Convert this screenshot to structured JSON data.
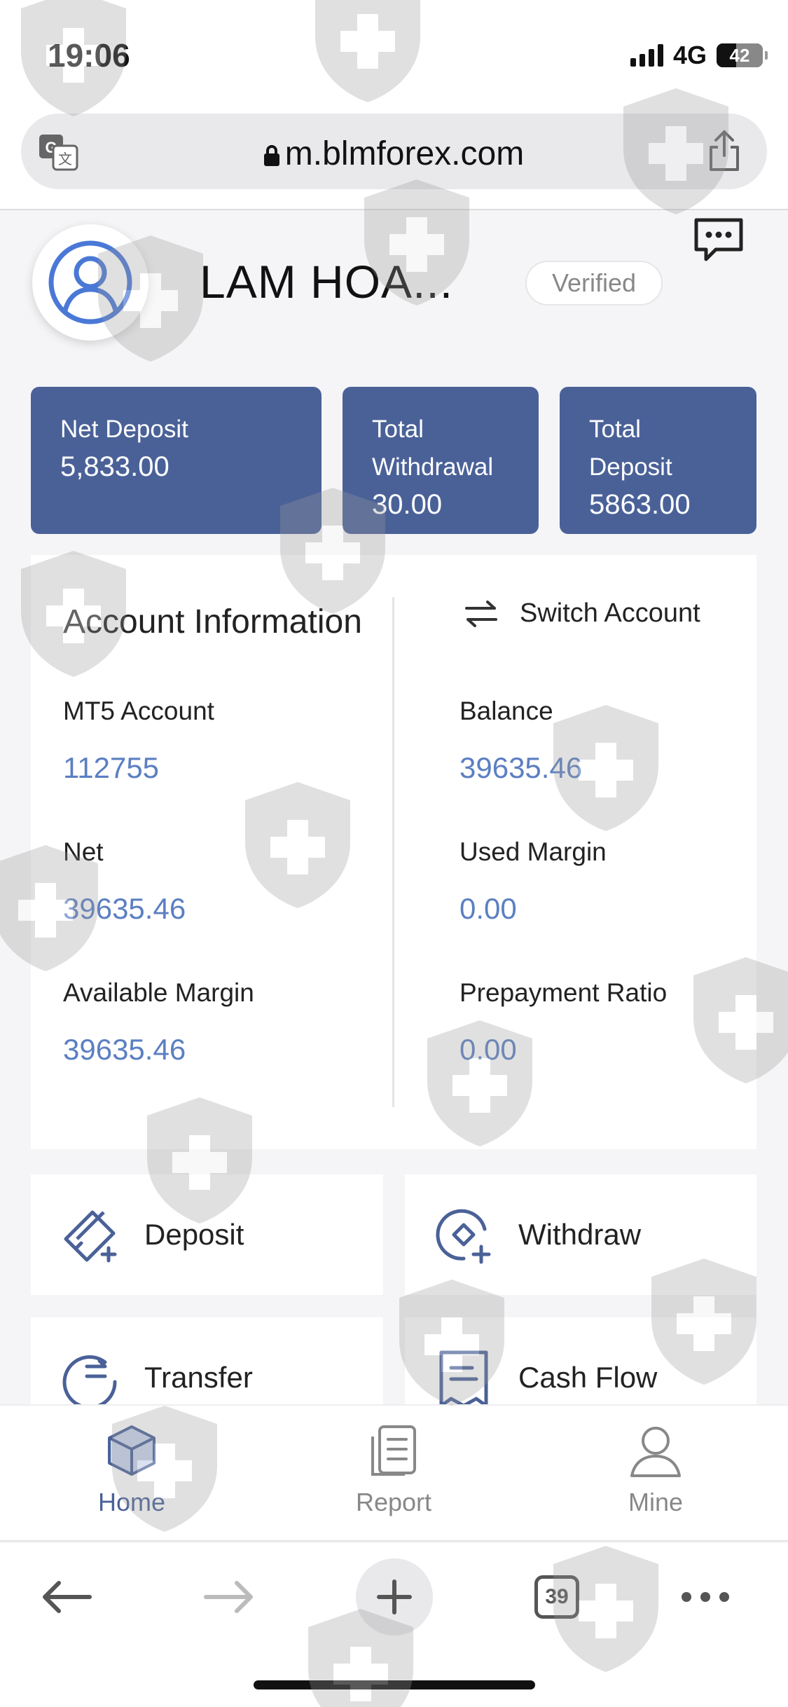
{
  "status_bar": {
    "time": "19:06",
    "network": "4G",
    "battery": "42"
  },
  "browser": {
    "url": "m.blmforex.com",
    "tab_count": "39"
  },
  "profile": {
    "name": "LAM HOA...",
    "badge": "Verified"
  },
  "summary_cards": [
    {
      "label": "Net Deposit",
      "value": "5,833.00"
    },
    {
      "label": "Total Withdrawal",
      "value": "30.00"
    },
    {
      "label": "Total Deposit",
      "value": "5863.00"
    }
  ],
  "account": {
    "title": "Account Information",
    "switch_label": "Switch Account",
    "fields": [
      {
        "label": "MT5 Account",
        "value": "112755"
      },
      {
        "label": "Balance",
        "value": "39635.46"
      },
      {
        "label": "Net",
        "value": "39635.46"
      },
      {
        "label": "Used Margin",
        "value": "0.00"
      },
      {
        "label": "Available Margin",
        "value": "39635.46"
      },
      {
        "label": "Prepayment Ratio",
        "value": "0.00"
      }
    ]
  },
  "actions": [
    {
      "label": "Deposit",
      "icon": "deposit-card-icon"
    },
    {
      "label": "Withdraw",
      "icon": "withdraw-icon"
    },
    {
      "label": "Transfer",
      "icon": "transfer-icon"
    },
    {
      "label": "Cash Flow",
      "icon": "receipt-icon"
    }
  ],
  "tabs": [
    {
      "label": "Home",
      "icon": "cube-icon",
      "active": true
    },
    {
      "label": "Report",
      "icon": "document-icon",
      "active": false
    },
    {
      "label": "Mine",
      "icon": "person-icon",
      "active": false
    }
  ],
  "colors": {
    "accent": "#4a6198",
    "value_text": "#5b7fc2",
    "card_bg": "#4a6198"
  }
}
